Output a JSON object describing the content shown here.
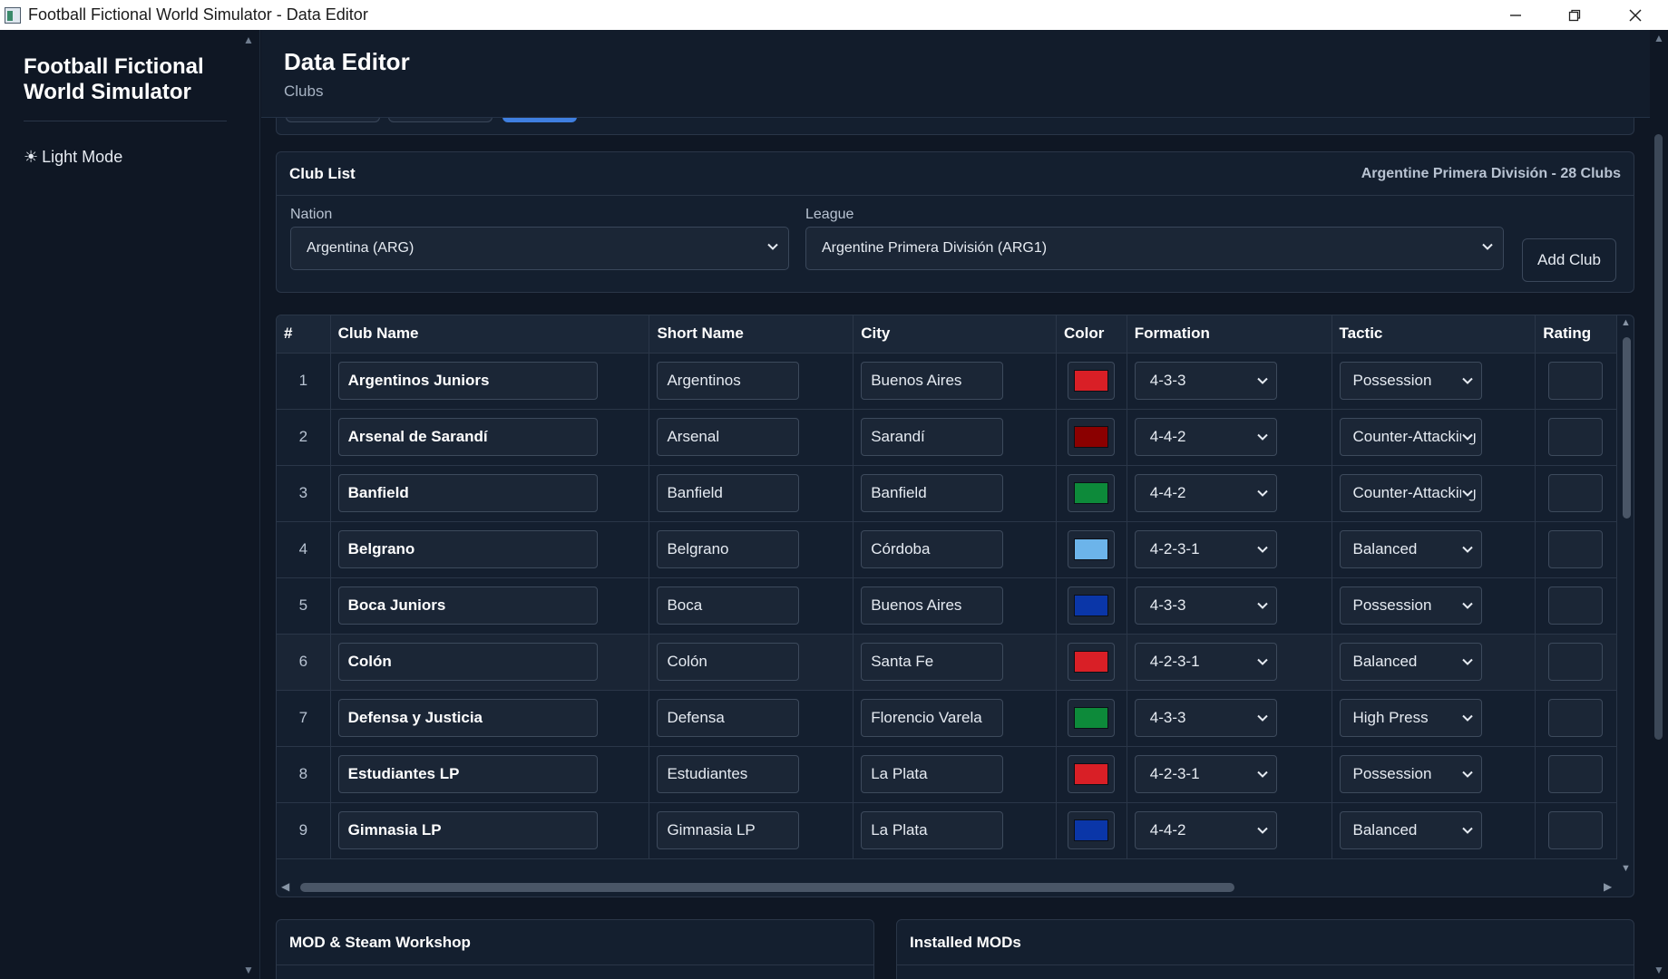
{
  "window": {
    "title": "Football Fictional World Simulator - Data Editor",
    "minimize_icon": "minimize-icon",
    "maximize_icon": "restore-icon",
    "close_icon": "close-icon"
  },
  "sidebar": {
    "brand": "Football Fictional World Simulator",
    "mode_icon": "☀",
    "mode_label": "Light Mode"
  },
  "header": {
    "title": "Data Editor",
    "subtitle": "Clubs"
  },
  "club_list": {
    "title": "Club List",
    "info": "Argentine Primera División - 28 Clubs",
    "nation_label": "Nation",
    "nation_value": "Argentina (ARG)",
    "league_label": "League",
    "league_value": "Argentine Primera División (ARG1)",
    "add_button": "Add Club"
  },
  "table": {
    "columns": [
      "#",
      "Club Name",
      "Short Name",
      "City",
      "Color",
      "Formation",
      "Tactic",
      "Rating"
    ],
    "rows": [
      {
        "num": "1",
        "name": "Argentinos Juniors",
        "short": "Argentinos",
        "city": "Buenos Aires",
        "color": "#d91f26",
        "formation": "4-3-3",
        "tactic": "Possession"
      },
      {
        "num": "2",
        "name": "Arsenal de Sarandí",
        "short": "Arsenal",
        "city": "Sarandí",
        "color": "#8b0000",
        "formation": "4-4-2",
        "tactic": "Counter-Attacking"
      },
      {
        "num": "3",
        "name": "Banfield",
        "short": "Banfield",
        "city": "Banfield",
        "color": "#0d8a3a",
        "formation": "4-4-2",
        "tactic": "Counter-Attacking"
      },
      {
        "num": "4",
        "name": "Belgrano",
        "short": "Belgrano",
        "city": "Córdoba",
        "color": "#6cb4ea",
        "formation": "4-2-3-1",
        "tactic": "Balanced"
      },
      {
        "num": "5",
        "name": "Boca Juniors",
        "short": "Boca",
        "city": "Buenos Aires",
        "color": "#0a36a8",
        "formation": "4-3-3",
        "tactic": "Possession"
      },
      {
        "num": "6",
        "name": "Colón",
        "short": "Colón",
        "city": "Santa Fe",
        "color": "#d91f26",
        "formation": "4-2-3-1",
        "tactic": "Balanced"
      },
      {
        "num": "7",
        "name": "Defensa y Justicia",
        "short": "Defensa",
        "city": "Florencio Varela",
        "color": "#0d8a3a",
        "formation": "4-3-3",
        "tactic": "High Press"
      },
      {
        "num": "8",
        "name": "Estudiantes LP",
        "short": "Estudiantes",
        "city": "La Plata",
        "color": "#d91f26",
        "formation": "4-2-3-1",
        "tactic": "Possession"
      },
      {
        "num": "9",
        "name": "Gimnasia LP",
        "short": "Gimnasia LP",
        "city": "La Plata",
        "color": "#0a36a8",
        "formation": "4-4-2",
        "tactic": "Balanced"
      }
    ]
  },
  "cards": {
    "mod_title": "MOD & Steam Workshop",
    "installed_title": "Installed MODs"
  }
}
